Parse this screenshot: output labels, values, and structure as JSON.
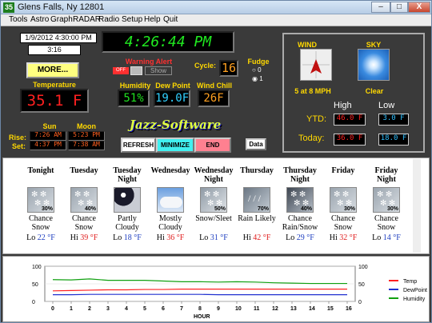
{
  "window": {
    "badge": "35",
    "title": "Glens Falls, Ny  12801",
    "min": "–",
    "max": "□",
    "close": "X"
  },
  "menu": [
    "Tools",
    "Astro",
    "Graph",
    "RADAR",
    "Radio",
    "Setup",
    "Help",
    "Quit"
  ],
  "datetime": {
    "date": "1/9/2012 4:30:00 PM",
    "countdown": "3:16",
    "clock": "4:26:44 PM"
  },
  "more_label": "MORE...",
  "warning": {
    "label": "Warning Alert",
    "off": "OFF",
    "show": "Show"
  },
  "cycle": {
    "label": "Cycle:",
    "value": "16"
  },
  "fudge": {
    "label": "Fudge",
    "opt0": "0",
    "opt1": "1"
  },
  "temperature": {
    "label": "Temperature",
    "value": "35.1 F"
  },
  "humidity": {
    "label": "Humidity",
    "value": "51%"
  },
  "dewpoint": {
    "label": "Dew Point",
    "value": "19.0F"
  },
  "windchill": {
    "label": "Wind Chill",
    "value": "26F"
  },
  "sun": {
    "label": "Sun",
    "rise": "7:26 AM",
    "set": "4:37 PM"
  },
  "moon": {
    "label": "Moon",
    "rise": "5:23 PM",
    "set": "7:38 AM"
  },
  "riseset": {
    "rise": "Rise:",
    "set": "Set:"
  },
  "brand": "Jazz-Software",
  "buttons": {
    "refresh": "REFRESH",
    "minimize": "MINIMIZE",
    "end": "END",
    "data": "Data"
  },
  "wind": {
    "label": "WIND",
    "text": "5 at 8 MPH"
  },
  "sky": {
    "label": "SKY",
    "text": "Clear"
  },
  "hilo": {
    "high": "High",
    "low": "Low",
    "ytd": "YTD:",
    "today": "Today:",
    "ytd_high": "46.0 F",
    "ytd_low": "3.0 F",
    "today_high": "36.0 F",
    "today_low": "18.0 F"
  },
  "forecast": [
    {
      "name": "Tonight",
      "pct": "30%",
      "cond": "Chance Snow",
      "hl": "Lo",
      "temp": "22 °F",
      "icon": "snow-icon"
    },
    {
      "name": "Tuesday",
      "pct": "40%",
      "cond": "Chance Snow",
      "hl": "Hi",
      "temp": "39 °F",
      "icon": "snow-icon"
    },
    {
      "name": "Tuesday Night",
      "pct": "",
      "cond": "Partly Cloudy",
      "hl": "Lo",
      "temp": "18 °F",
      "icon": "partly-cloudy-night-icon"
    },
    {
      "name": "Wednesday",
      "pct": "",
      "cond": "Mostly Cloudy",
      "hl": "Hi",
      "temp": "36 °F",
      "icon": "mostly-cloudy-icon"
    },
    {
      "name": "Wednesday Night",
      "pct": "50%",
      "cond": "Snow/Sleet",
      "hl": "Lo",
      "temp": "31 °F",
      "icon": "snow-sleet-icon"
    },
    {
      "name": "Thursday",
      "pct": "70%",
      "cond": "Rain Likely",
      "hl": "Hi",
      "temp": "42 °F",
      "icon": "rain-icon"
    },
    {
      "name": "Thursday Night",
      "pct": "40%",
      "cond": "Chance Rain/Snow",
      "hl": "Lo",
      "temp": "29 °F",
      "icon": "rain-snow-night-icon"
    },
    {
      "name": "Friday",
      "pct": "30%",
      "cond": "Chance Snow",
      "hl": "Hi",
      "temp": "32 °F",
      "icon": "snow-icon"
    },
    {
      "name": "Friday Night",
      "pct": "30%",
      "cond": "Chance Snow",
      "hl": "Lo",
      "temp": "14 °F",
      "icon": "snow-icon"
    }
  ],
  "chart_data": {
    "type": "line",
    "x": [
      0,
      1,
      2,
      3,
      4,
      5,
      6,
      7,
      8,
      9,
      10,
      11,
      12,
      13,
      14,
      15,
      16
    ],
    "xlabel": "HOUR",
    "ylim": [
      0,
      100
    ],
    "yticks": [
      "100",
      "50",
      "0"
    ],
    "series": [
      {
        "name": "Temp",
        "color": "#ff2020",
        "values": [
          30,
          31,
          32,
          33,
          33,
          34,
          34,
          35,
          35,
          35,
          35,
          35,
          35,
          35,
          35,
          35,
          35
        ]
      },
      {
        "name": "DewPoint",
        "color": "#2030d0",
        "values": [
          19,
          19,
          20,
          20,
          20,
          20,
          20,
          20,
          20,
          19,
          19,
          19,
          19,
          19,
          19,
          19,
          19
        ]
      },
      {
        "name": "Humidity",
        "color": "#10a010",
        "values": [
          62,
          61,
          64,
          60,
          60,
          60,
          58,
          56,
          56,
          55,
          56,
          55,
          53,
          52,
          51,
          51,
          51
        ]
      }
    ]
  }
}
